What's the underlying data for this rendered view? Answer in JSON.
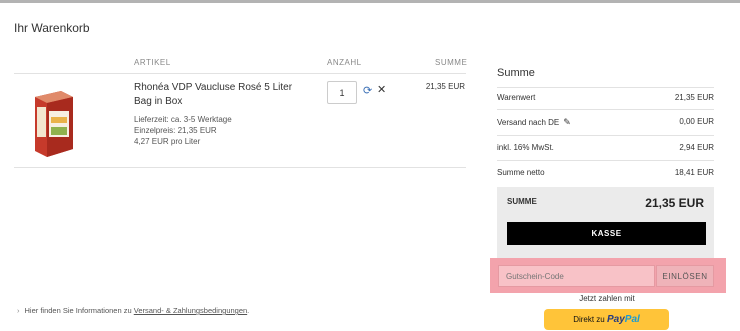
{
  "page": {
    "title": "Ihr Warenkorb"
  },
  "cart": {
    "columns": {
      "article": "ARTIKEL",
      "quantity": "ANZAHL",
      "sum": "SUMME"
    },
    "item": {
      "name": "Rhonéa VDP Vaucluse Rosé 5 Liter Bag in Box",
      "delivery": "Lieferzeit: ca. 3-5 Werktage",
      "unit_price": "Einzelpreis: 21,35 EUR",
      "per_liter": "4,27 EUR pro Liter",
      "quantity": "1",
      "line_total": "21,35 EUR"
    },
    "footer_note": {
      "prefix": "Hier finden Sie Informationen zu",
      "link": "Versand- & Zahlungsbedingungen",
      "suffix": "."
    }
  },
  "summary": {
    "title": "Summe",
    "rows": [
      {
        "label": "Warenwert",
        "value": "21,35 EUR"
      },
      {
        "label": "Versand nach DE",
        "value": "0,00 EUR"
      },
      {
        "label": "inkl. 16% MwSt.",
        "value": "2,94 EUR"
      },
      {
        "label": "Summe netto",
        "value": "18,41 EUR"
      }
    ],
    "total_label": "SUMME",
    "total_value": "21,35 EUR",
    "checkout_label": "KASSE",
    "coupon_placeholder": "Gutschein-Code",
    "coupon_button": "EINLÖSEN",
    "pay_now_text": "Jetzt zahlen mit",
    "paypal": {
      "prefix": "Direkt zu",
      "brand_a": "Pay",
      "brand_b": "Pal"
    }
  }
}
